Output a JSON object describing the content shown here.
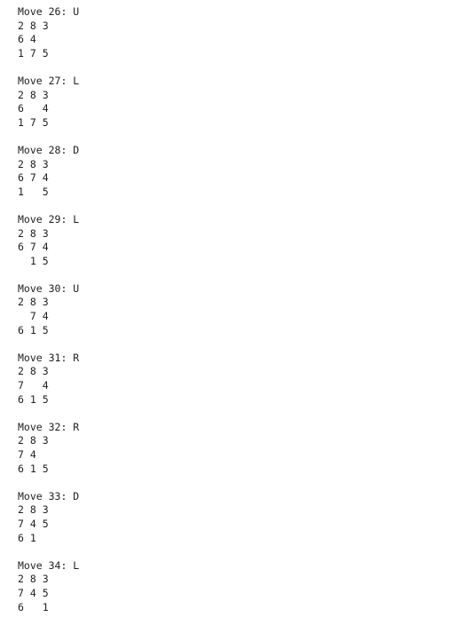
{
  "moves": [
    {
      "header": "Move 26: U",
      "rows": [
        "2 8 3",
        "6 4",
        "1 7 5"
      ]
    },
    {
      "header": "Move 27: L",
      "rows": [
        "2 8 3",
        "6   4",
        "1 7 5"
      ]
    },
    {
      "header": "Move 28: D",
      "rows": [
        "2 8 3",
        "6 7 4",
        "1   5"
      ]
    },
    {
      "header": "Move 29: L",
      "rows": [
        "2 8 3",
        "6 7 4",
        "  1 5"
      ]
    },
    {
      "header": "Move 30: U",
      "rows": [
        "2 8 3",
        "  7 4",
        "6 1 5"
      ]
    },
    {
      "header": "Move 31: R",
      "rows": [
        "2 8 3",
        "7   4",
        "6 1 5"
      ]
    },
    {
      "header": "Move 32: R",
      "rows": [
        "2 8 3",
        "7 4",
        "6 1 5"
      ]
    },
    {
      "header": "Move 33: D",
      "rows": [
        "2 8 3",
        "7 4 5",
        "6 1"
      ]
    },
    {
      "header": "Move 34: L",
      "rows": [
        "2 8 3",
        "7 4 5",
        "6   1"
      ]
    }
  ]
}
